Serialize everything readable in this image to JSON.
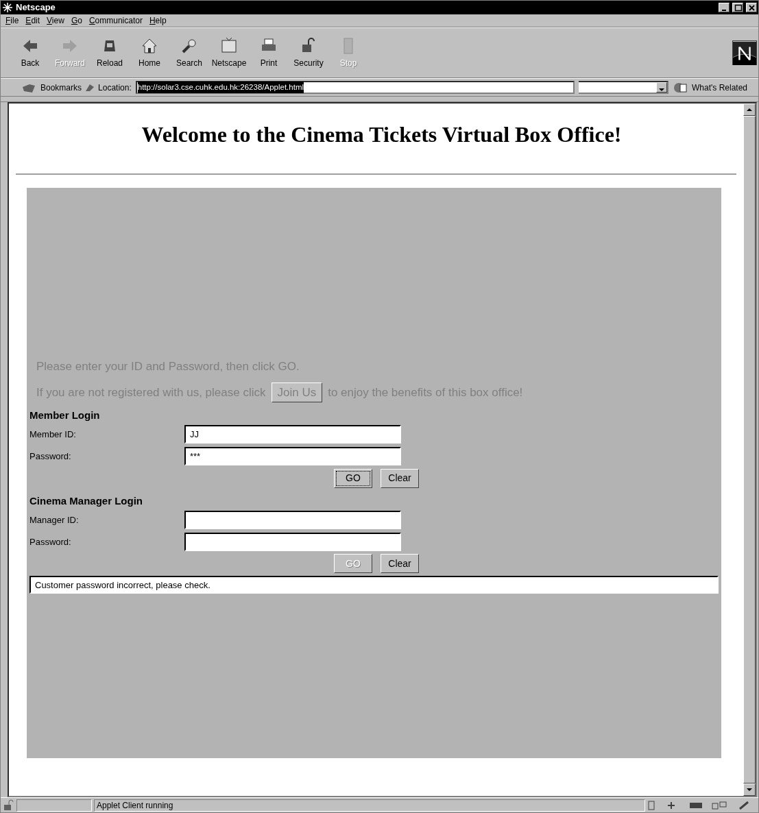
{
  "window": {
    "title": "Netscape"
  },
  "menu": [
    "File",
    "Edit",
    "View",
    "Go",
    "Communicator",
    "Help"
  ],
  "toolbar": [
    {
      "label": "Back",
      "disabled": false
    },
    {
      "label": "Forward",
      "disabled": true
    },
    {
      "label": "Reload",
      "disabled": false
    },
    {
      "label": "Home",
      "disabled": false
    },
    {
      "label": "Search",
      "disabled": false
    },
    {
      "label": "Netscape",
      "disabled": false
    },
    {
      "label": "Print",
      "disabled": false
    },
    {
      "label": "Security",
      "disabled": false
    },
    {
      "label": "Stop",
      "disabled": true
    }
  ],
  "location_bar": {
    "bookmarks": "Bookmarks",
    "location_label": "Location:",
    "url": "http://solar3.cse.cuhk.edu.hk:26238/Applet.html",
    "whats_related": "What's Related"
  },
  "page": {
    "heading": "Welcome to the Cinema Tickets Virtual Box Office!",
    "applet": {
      "intro": "Please enter your ID and Password, then click GO.",
      "join_before": "If you are not registered with us, please click",
      "join_button": "Join Us",
      "join_after": "to enjoy the benefits of this box office!",
      "sections": [
        {
          "title": "Member Login",
          "fields": [
            {
              "label": "Member ID:",
              "value": "JJ"
            },
            {
              "label": "Password:",
              "value": "***"
            }
          ],
          "buttons": [
            {
              "label": "GO",
              "disabled": false,
              "focused": true
            },
            {
              "label": "Clear",
              "disabled": false,
              "focused": false
            }
          ]
        },
        {
          "title": "Cinema Manager Login",
          "fields": [
            {
              "label": "Manager ID:"
            },
            {
              "label": "Password:"
            }
          ],
          "buttons": [
            {
              "label": "GO",
              "disabled": true,
              "focused": false
            },
            {
              "label": "Clear",
              "disabled": false,
              "focused": false
            }
          ]
        }
      ],
      "message": "Customer password incorrect, please check."
    }
  },
  "status_bar": {
    "text": "Applet Client running"
  }
}
